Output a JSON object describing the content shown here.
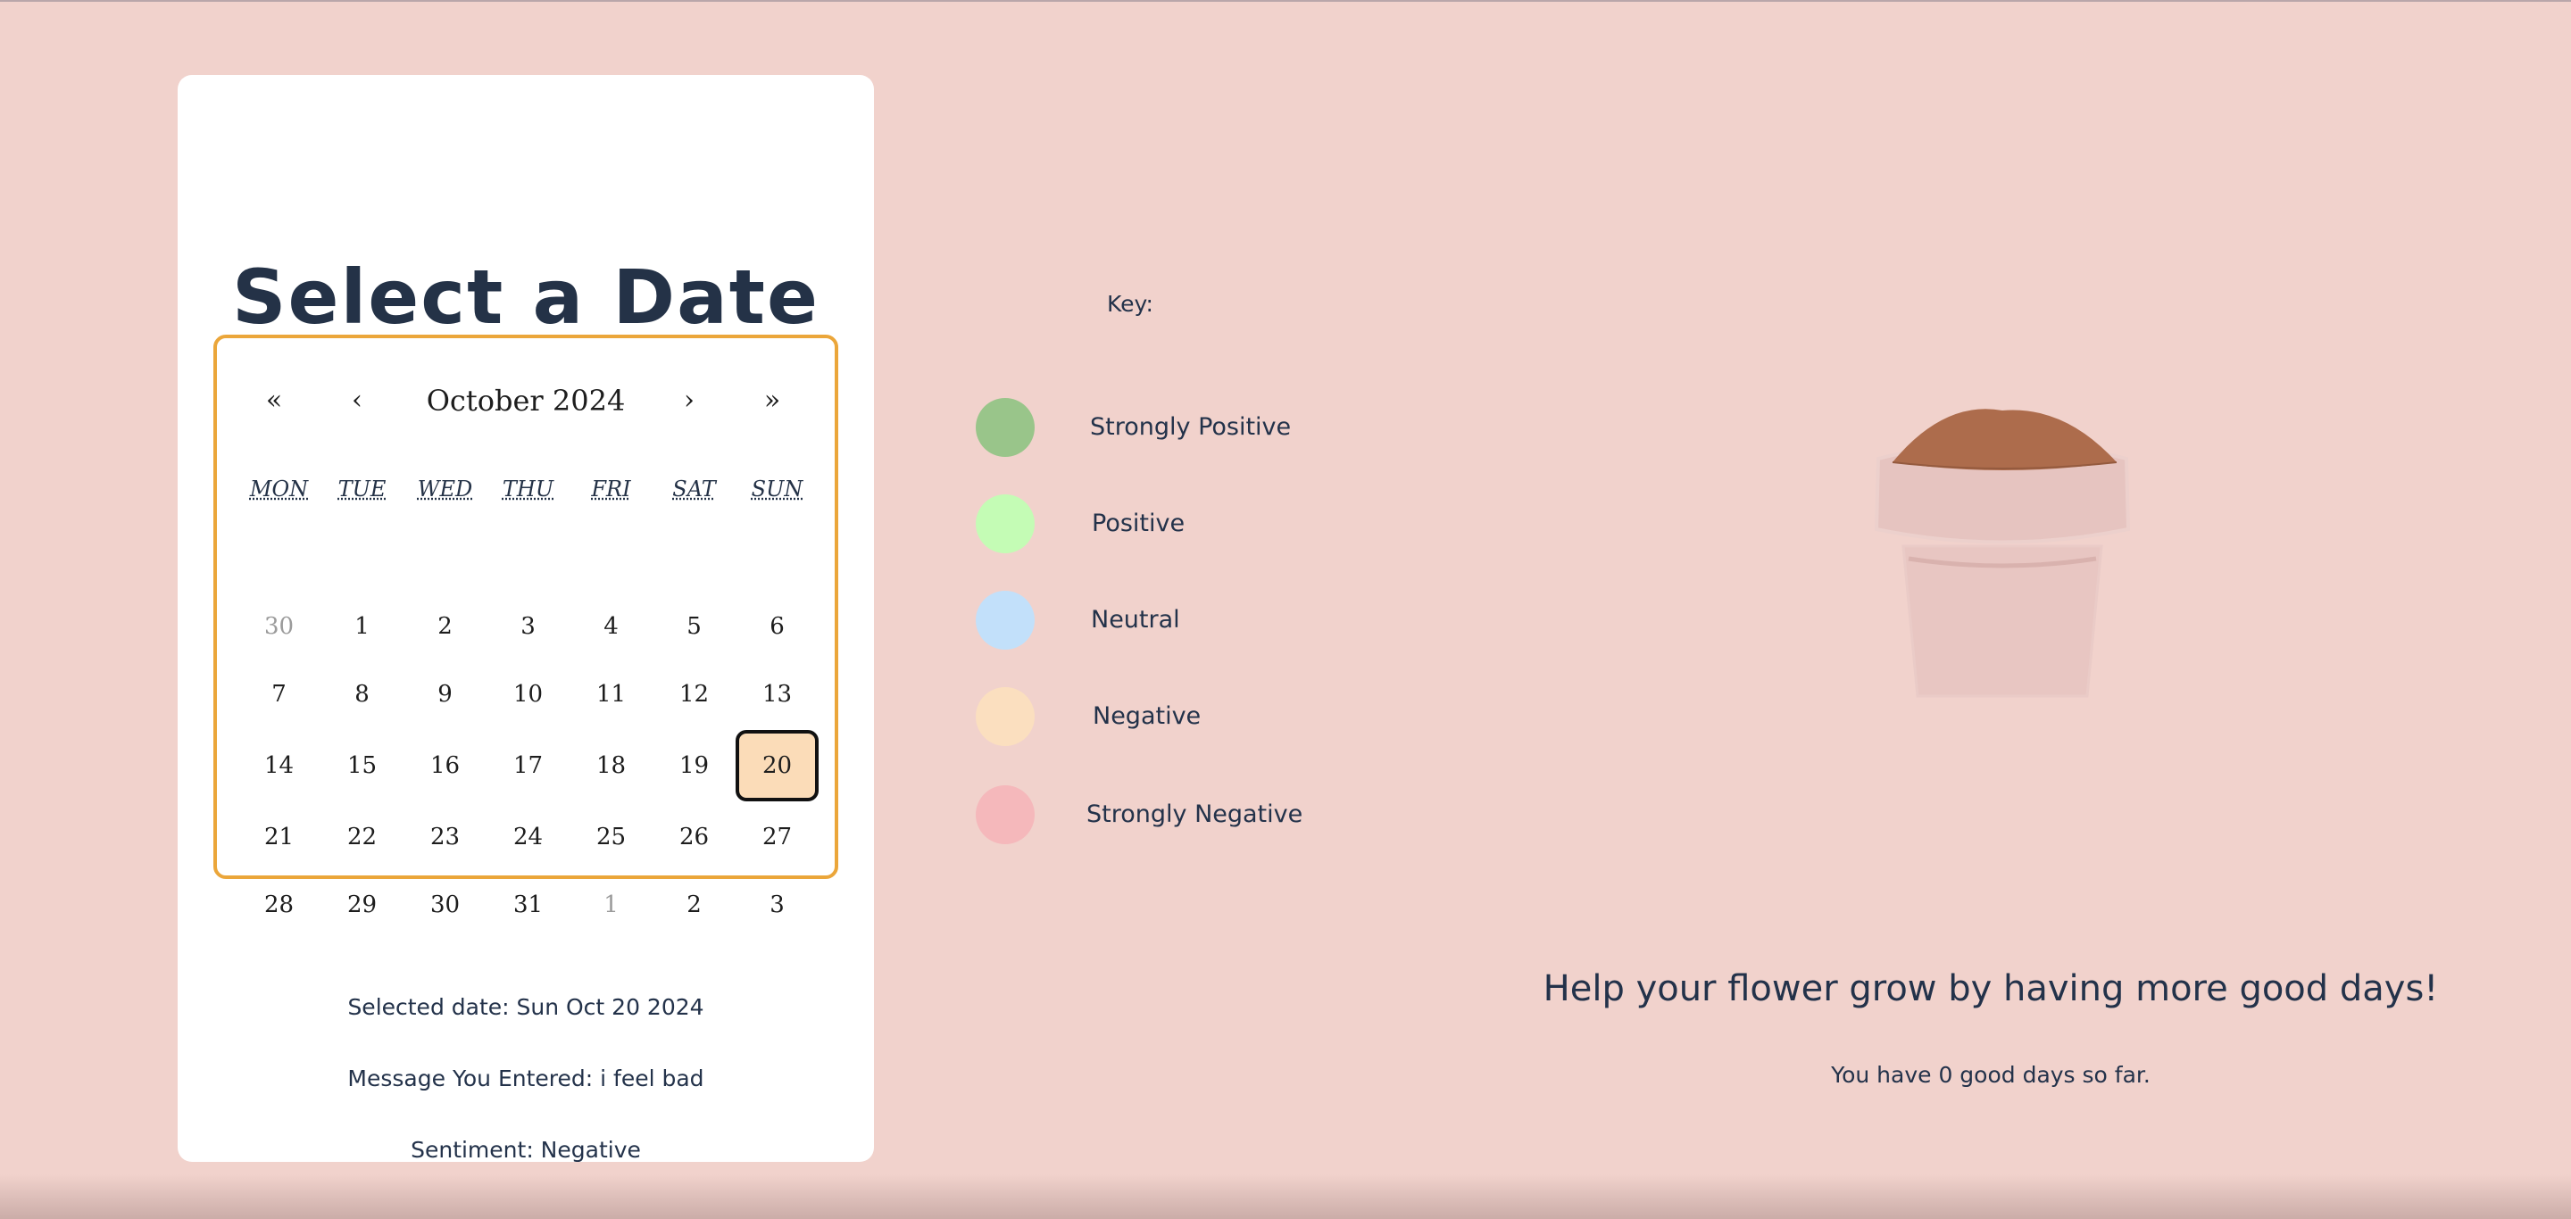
{
  "card": {
    "title": "Select a Date",
    "calendar": {
      "prev_year": "«",
      "prev_month": "‹",
      "month_label": "October 2024",
      "next_month": "›",
      "next_year": "»",
      "weekdays": [
        "MON",
        "TUE",
        "WED",
        "THU",
        "FRI",
        "SAT",
        "SUN"
      ],
      "weeks": [
        [
          "30",
          "1",
          "2",
          "3",
          "4",
          "5",
          "6"
        ],
        [
          "7",
          "8",
          "9",
          "10",
          "11",
          "12",
          "13"
        ],
        [
          "14",
          "15",
          "16",
          "17",
          "18",
          "19",
          "20"
        ],
        [
          "21",
          "22",
          "23",
          "24",
          "25",
          "26",
          "27"
        ],
        [
          "28",
          "29",
          "30",
          "31",
          "1",
          "2",
          "3"
        ]
      ],
      "selected_day": "20"
    },
    "selected_date_text": "Selected date: Sun Oct 20 2024",
    "message_text": "Message You Entered: i feel bad",
    "sentiment_text": "Sentiment: Negative"
  },
  "legend": {
    "label": "Key:",
    "items": [
      {
        "label": "Strongly Positive",
        "color": "#99c58a"
      },
      {
        "label": "Positive",
        "color": "#c4fcb5"
      },
      {
        "label": "Neutral",
        "color": "#c2e0fa"
      },
      {
        "label": "Negative",
        "color": "#fbdfbf"
      },
      {
        "label": "Strongly Negative",
        "color": "#f5b8bb"
      }
    ]
  },
  "flower": {
    "headline": "Help your flower grow by having more good days!",
    "good_days_text": "You have 0 good days so far."
  },
  "colors": {
    "background": "#f1d2cc",
    "calendar_border": "#eba63a",
    "selected_day_bg": "#fbdcb8",
    "soil": "#ad6c4c",
    "pot": "#e8c6c2"
  }
}
